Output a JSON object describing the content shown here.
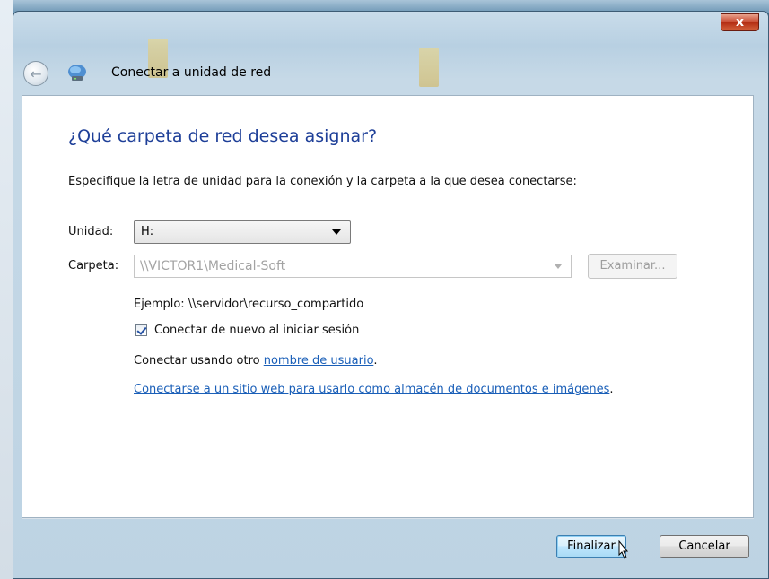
{
  "window": {
    "title": "Conectar a unidad de red",
    "close_glyph": "x"
  },
  "page": {
    "heading": "¿Qué carpeta de red desea asignar?",
    "instructions": "Especifique la letra de unidad para la conexión y la carpeta a la que desea conectarse:"
  },
  "form": {
    "drive_label": "Unidad:",
    "drive_value": "H:",
    "folder_label": "Carpeta:",
    "folder_value": "\\\\VICTOR1\\Medical-Soft",
    "browse_label": "Examinar...",
    "example": "Ejemplo: \\\\servidor\\recurso_compartido",
    "reconnect_label": "Conectar de nuevo al iniciar sesión",
    "reconnect_checked": true,
    "other_user_prefix": "Conectar usando otro ",
    "other_user_link": "nombre de usuario",
    "other_user_suffix": ".",
    "website_link": "Conectarse a un sitio web para usarlo como almacén de documentos e imágenes",
    "website_suffix": "."
  },
  "footer": {
    "finish_label": "Finalizar",
    "cancel_label": "Cancelar"
  },
  "icons": {
    "back": "back-arrow-icon",
    "network": "network-drive-icon",
    "close": "close-icon",
    "cursor": "mouse-pointer-icon"
  },
  "colors": {
    "heading": "#1e3f98",
    "link": "#1a5fb8",
    "close_button": "#c6452b",
    "default_button": "#bee6fd"
  }
}
